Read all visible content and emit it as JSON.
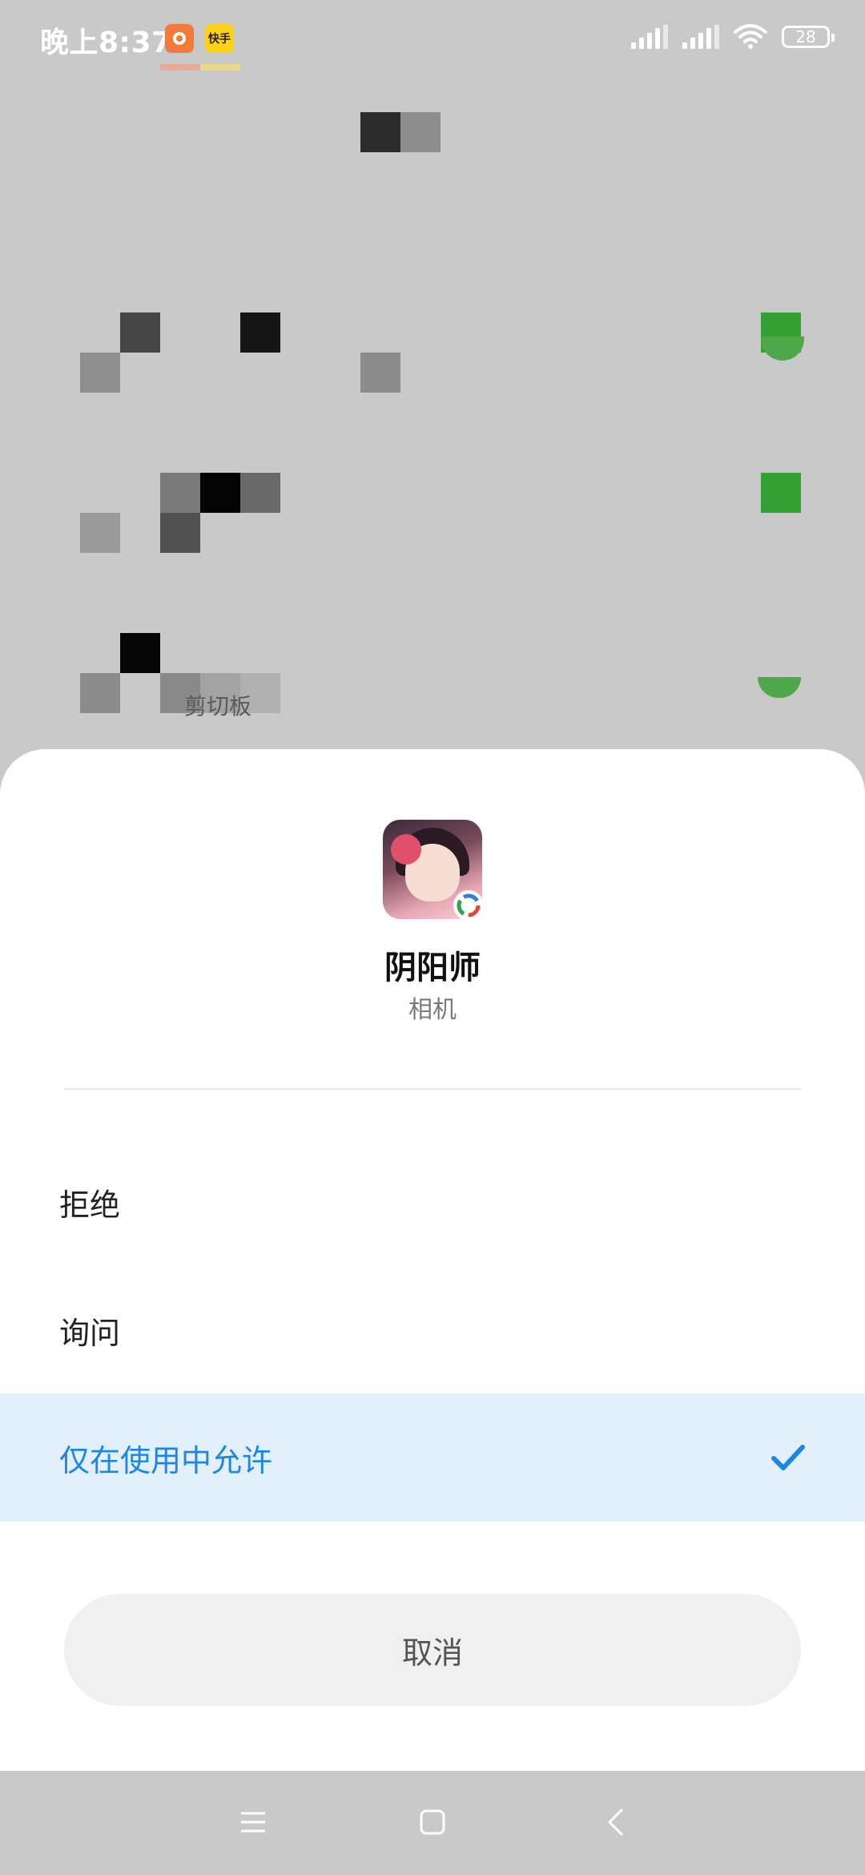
{
  "status_bar": {
    "time": "晚上8:37",
    "app_icons": [
      {
        "name": "orange-app-icon",
        "text": "",
        "color": "#f27a3a"
      },
      {
        "name": "kuaishou-app-icon",
        "text": "快手",
        "color": "#ffd21a"
      }
    ],
    "battery": "28"
  },
  "background": {
    "label": "剪切板"
  },
  "dialog": {
    "app_name": "阴阳师",
    "permission": "相机",
    "options": [
      {
        "label": "拒绝",
        "selected": false
      },
      {
        "label": "询问",
        "selected": false
      },
      {
        "label": "仅在使用中允许",
        "selected": true
      }
    ],
    "cancel_label": "取消",
    "accent_color": "#1c86e6",
    "selected_bg": "#e3f0fc"
  },
  "nav_bar": {
    "buttons": [
      "menu-icon",
      "home-icon",
      "back-icon"
    ]
  }
}
